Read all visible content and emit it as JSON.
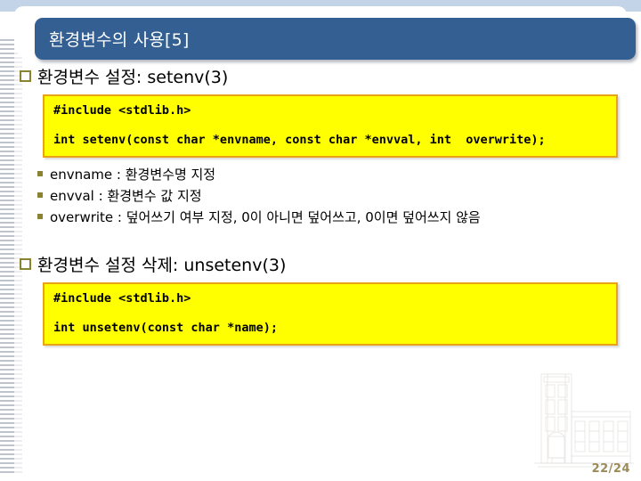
{
  "slide": {
    "title": "환경변수의 사용[5]",
    "page_number": "22/24",
    "colors": {
      "title_bar": "#335f92",
      "top_band": "#c3d3e8",
      "code_box_fill": "#ffff00",
      "code_box_border": "#e8a317",
      "bullet_marker": "#8a8432",
      "page_number": "#9c8b5a"
    },
    "sections": [
      {
        "heading": "환경변수 설정: setenv(3)",
        "marker": "hollow-square-bullet",
        "code": {
          "line1": "#include <stdlib.h>",
          "line2": "int setenv(const char *envname, const char *envval, int  overwrite);"
        },
        "items": [
          {
            "marker": "filled-square-bullet",
            "text": "envname : 환경변수명 지정"
          },
          {
            "marker": "filled-square-bullet",
            "text": "envval : 환경변수 값 지정"
          },
          {
            "marker": "filled-square-bullet",
            "text": "overwrite : 덮어쓰기 여부 지정, 0이 아니면 덮어쓰고, 0이면 덮어쓰지 않음"
          }
        ]
      },
      {
        "heading": "환경변수 설정 삭제: unsetenv(3)",
        "marker": "hollow-square-bullet",
        "code": {
          "line1": "#include <stdlib.h>",
          "line2": "int unsetenv(const char *name);"
        },
        "items": []
      }
    ],
    "decorations": {
      "watermark": "building-line-drawing",
      "left_ribbon": "horizontal-stripes"
    }
  }
}
